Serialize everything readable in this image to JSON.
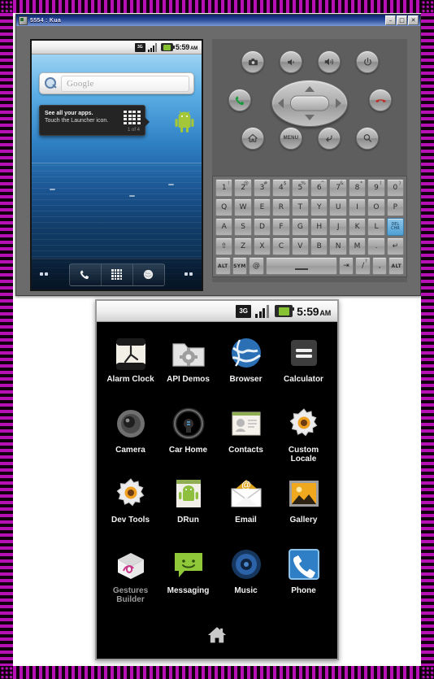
{
  "window": {
    "title": "5554 : Kua",
    "icon": "emulator-icon",
    "buttons": [
      {
        "name": "minimize-button",
        "glyph": "–"
      },
      {
        "name": "maximize-button",
        "glyph": "□"
      },
      {
        "name": "close-button",
        "glyph": "✕"
      }
    ]
  },
  "home_screen": {
    "status_bar": {
      "network_label": "3G",
      "signal_icon": "signal-bars-icon",
      "battery_icon": "battery-icon",
      "clock": "5:59",
      "meridiem": "AM"
    },
    "search_widget": {
      "icon": "search-magnifier-icon",
      "placeholder": "Google"
    },
    "hint_bubble": {
      "line1": "See all your apps.",
      "line2": "Touch the Launcher icon.",
      "counter": "1 of 4",
      "grid_icon": "launcher-grid-icon"
    },
    "mascot_icon": "android-mascot-icon",
    "dock": [
      {
        "name": "dock-phone-button",
        "icon": "phone-handset-icon"
      },
      {
        "name": "dock-launcher-button",
        "icon": "launcher-grid-icon"
      },
      {
        "name": "dock-browser-button",
        "icon": "browser-globe-icon"
      }
    ]
  },
  "controls": {
    "row1": [
      {
        "name": "camera-button",
        "icon": "camera-icon",
        "label": ""
      },
      {
        "name": "volume-down-button",
        "icon": "volume-down-icon",
        "label": ""
      },
      {
        "name": "volume-up-button",
        "icon": "volume-up-icon",
        "label": ""
      },
      {
        "name": "power-button",
        "icon": "power-icon",
        "label": ""
      }
    ],
    "call_button": {
      "name": "call-button",
      "icon": "call-green-icon"
    },
    "end_call_button": {
      "name": "end-call-button",
      "icon": "end-call-red-icon"
    },
    "dpad": {
      "name": "dpad",
      "up": "dpad-up-icon",
      "down": "dpad-down-icon",
      "left": "dpad-left-icon",
      "right": "dpad-right-icon",
      "center": "dpad-center-button"
    },
    "row3": [
      {
        "name": "home-button",
        "icon": "home-icon",
        "label": ""
      },
      {
        "name": "menu-button",
        "icon": "menu-icon",
        "label": "MENU"
      },
      {
        "name": "back-button",
        "icon": "back-arrow-icon",
        "label": ""
      },
      {
        "name": "search-button",
        "icon": "search-icon",
        "label": ""
      }
    ]
  },
  "keyboard": {
    "rows": [
      [
        {
          "main": "1",
          "sup": "!"
        },
        {
          "main": "2",
          "sup": "@"
        },
        {
          "main": "3",
          "sup": "#"
        },
        {
          "main": "4",
          "sup": "$"
        },
        {
          "main": "5",
          "sup": "%"
        },
        {
          "main": "6",
          "sup": "^"
        },
        {
          "main": "7",
          "sup": "&"
        },
        {
          "main": "8",
          "sup": "*"
        },
        {
          "main": "9",
          "sup": "("
        },
        {
          "main": "0",
          "sup": ")"
        }
      ],
      [
        {
          "main": "Q",
          "sup": ""
        },
        {
          "main": "W",
          "sup": ""
        },
        {
          "main": "E",
          "sup": ""
        },
        {
          "main": "R",
          "sup": ""
        },
        {
          "main": "T",
          "sup": ""
        },
        {
          "main": "Y",
          "sup": ""
        },
        {
          "main": "U",
          "sup": ""
        },
        {
          "main": "I",
          "sup": ""
        },
        {
          "main": "O",
          "sup": ""
        },
        {
          "main": "P",
          "sup": ""
        }
      ],
      [
        {
          "main": "A",
          "sup": ""
        },
        {
          "main": "S",
          "sup": ""
        },
        {
          "main": "D",
          "sup": ""
        },
        {
          "main": "F",
          "sup": ""
        },
        {
          "main": "G",
          "sup": ""
        },
        {
          "main": "H",
          "sup": ""
        },
        {
          "main": "J",
          "sup": ""
        },
        {
          "main": "K",
          "sup": ""
        },
        {
          "main": "L",
          "sup": ""
        },
        {
          "main": "DEL",
          "sup": ""
        }
      ],
      [
        {
          "main": "⇧",
          "sup": ""
        },
        {
          "main": "Z",
          "sup": ""
        },
        {
          "main": "X",
          "sup": ""
        },
        {
          "main": "C",
          "sup": ""
        },
        {
          "main": "V",
          "sup": ""
        },
        {
          "main": "B",
          "sup": ""
        },
        {
          "main": "N",
          "sup": ""
        },
        {
          "main": "M",
          "sup": ""
        },
        {
          "main": ".",
          "sup": ""
        },
        {
          "main": "↵",
          "sup": ""
        }
      ],
      [
        {
          "main": "ALT",
          "sup": ""
        },
        {
          "main": "SYM",
          "sup": ""
        },
        {
          "main": "@",
          "sup": ""
        },
        {
          "main": "",
          "sup": ""
        },
        {
          "main": "⇥",
          "sup": ""
        },
        {
          "main": "/",
          "sup": "?"
        },
        {
          "main": ",",
          "sup": ""
        },
        {
          "main": "ALT",
          "sup": ""
        }
      ]
    ],
    "del_label_top": "DEL",
    "del_label_bottom": "CHR"
  },
  "app_drawer": {
    "status_bar": {
      "network_label": "3G",
      "signal_icon": "signal-bars-icon",
      "battery_icon": "battery-icon",
      "clock": "5:59",
      "meridiem": "AM"
    },
    "apps": [
      {
        "label": "Alarm Clock",
        "icon": "alarm-clock-icon",
        "dim": false
      },
      {
        "label": "API Demos",
        "icon": "api-demos-folder-icon",
        "dim": false
      },
      {
        "label": "Browser",
        "icon": "browser-globe-icon",
        "dim": false
      },
      {
        "label": "Calculator",
        "icon": "calculator-icon",
        "dim": false
      },
      {
        "label": "Camera",
        "icon": "camera-lens-icon",
        "dim": false
      },
      {
        "label": "Car Home",
        "icon": "car-steering-wheel-icon",
        "dim": false
      },
      {
        "label": "Contacts",
        "icon": "contacts-card-icon",
        "dim": false
      },
      {
        "label": "Custom Locale",
        "icon": "custom-locale-gear-icon",
        "dim": false
      },
      {
        "label": "Dev Tools",
        "icon": "dev-tools-gear-icon",
        "dim": false
      },
      {
        "label": "DRun",
        "icon": "drun-android-icon",
        "dim": false
      },
      {
        "label": "Email",
        "icon": "email-envelope-icon",
        "dim": false
      },
      {
        "label": "Gallery",
        "icon": "gallery-photo-icon",
        "dim": false
      },
      {
        "label": "Gestures Builder",
        "icon": "gestures-builder-icon",
        "dim": true
      },
      {
        "label": "Messaging",
        "icon": "messaging-bubble-icon",
        "dim": false
      },
      {
        "label": "Music",
        "icon": "music-speaker-icon",
        "dim": false
      },
      {
        "label": "Phone",
        "icon": "phone-handset-icon",
        "dim": false
      }
    ],
    "home_handle": {
      "name": "drawer-home-handle",
      "icon": "home-icon"
    }
  },
  "colors": {
    "frame_magenta": "#b60fb6",
    "title_blue": "#0a246a",
    "del_key_blue": "#4f9fd4",
    "battery_green": "#86c232",
    "call_green": "#2e9c4a",
    "end_call_red": "#c0392b"
  }
}
